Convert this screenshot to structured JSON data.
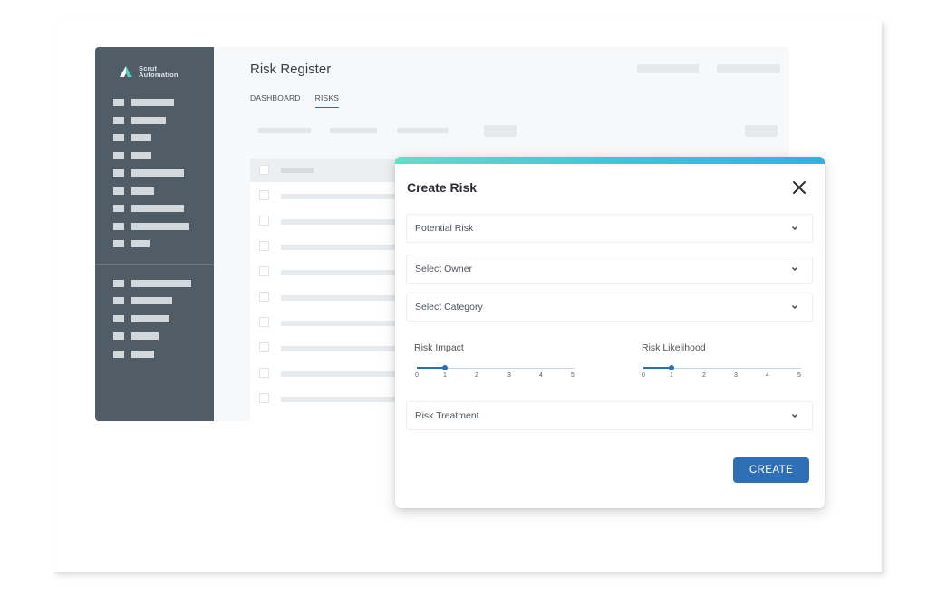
{
  "brand": {
    "name_line1": "Scrut",
    "name_line2": "Automation",
    "logo_icon": "scrut-logo-icon"
  },
  "page": {
    "title": "Risk Register"
  },
  "tabs": [
    {
      "label": "DASHBOARD",
      "active": false
    },
    {
      "label": "RISKS",
      "active": true
    }
  ],
  "modal": {
    "title": "Create Risk",
    "close_icon": "close-icon",
    "fields": {
      "potential_risk": "Potential Risk",
      "owner": "Select Owner",
      "category": "Select Category",
      "treatment": "Risk Treatment"
    },
    "risk_impact": {
      "label": "Risk Impact",
      "value": 1,
      "min": 0,
      "max": 5,
      "ticks": [
        "0",
        "1",
        "2",
        "3",
        "4",
        "5"
      ]
    },
    "risk_likelihood": {
      "label": "Risk Likelihood",
      "value": 1,
      "min": 0,
      "max": 5,
      "ticks": [
        "0",
        "1",
        "2",
        "3",
        "4",
        "5"
      ]
    },
    "create_label": "CREATE"
  },
  "colors": {
    "sidebar": "#505c66",
    "accent_start": "#5ee0c9",
    "accent_end": "#2fb3e0",
    "primary": "#2f6fb6"
  }
}
